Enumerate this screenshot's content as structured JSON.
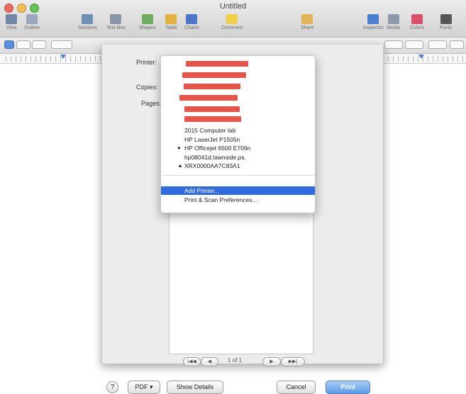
{
  "window": {
    "title": "Untitled"
  },
  "toolbar": {
    "items": [
      {
        "label": "View",
        "icon": "view-icon",
        "color": "#6f86a6"
      },
      {
        "label": "Outline",
        "icon": "outline-icon",
        "color": "#9aa8bb"
      },
      {
        "label": "Sections",
        "icon": "sections-icon",
        "color": "#6f8fb5"
      },
      {
        "label": "Text Box",
        "icon": "textbox-icon",
        "color": "#8a96a8"
      },
      {
        "label": "Shapes",
        "icon": "shapes-icon",
        "color": "#6fae5f"
      },
      {
        "label": "Table",
        "icon": "table-icon",
        "color": "#e3b13d"
      },
      {
        "label": "Charts",
        "icon": "charts-icon",
        "color": "#4b76c9"
      },
      {
        "label": "Comment",
        "icon": "comment-icon",
        "color": "#f2cf4a"
      },
      {
        "label": "Share",
        "icon": "share-icon",
        "color": "#e0b55a"
      },
      {
        "label": "Inspector",
        "icon": "inspector-icon",
        "color": "#4a7fd0"
      },
      {
        "label": "Media",
        "icon": "media-icon",
        "color": "#8c9aab"
      },
      {
        "label": "Colors",
        "icon": "colors-icon",
        "color": "#d94f6c"
      },
      {
        "label": "Fonts",
        "icon": "fonts-icon",
        "color": "#555555"
      }
    ]
  },
  "print_dialog": {
    "printer_label": "Printer:",
    "copies_label": "Copies:",
    "pages_label": "Pages:",
    "pager": {
      "first": "|◀◀",
      "prev": "◀",
      "page_status": "1 of 1",
      "next": "▶",
      "last": "▶▶|"
    },
    "buttons": {
      "help": "?",
      "pdf": "PDF ▾",
      "show_details": "Show Details",
      "cancel": "Cancel",
      "print": "Print"
    }
  },
  "printer_menu": {
    "redacted_count": 6,
    "printers": [
      {
        "name": "2015 Computer lab",
        "marker": ""
      },
      {
        "name": "HP LaserJet P1505n",
        "marker": ""
      },
      {
        "name": "HP Officejet 6500 E709n",
        "marker": "●"
      },
      {
        "name": "hp08041d.lawnside.ps.",
        "marker": ""
      },
      {
        "name": "XRX0000AA7C83A1",
        "marker": "▲"
      }
    ],
    "actions": [
      {
        "name": "Add Printer...",
        "highlighted": true
      },
      {
        "name": "Print & Scan Preferences...",
        "highlighted": false
      }
    ],
    "checkmark": "✓"
  },
  "colors": {
    "highlight": "#2f6ae0",
    "redaction": "#e8534a",
    "print_button": "#5d9ce8"
  }
}
